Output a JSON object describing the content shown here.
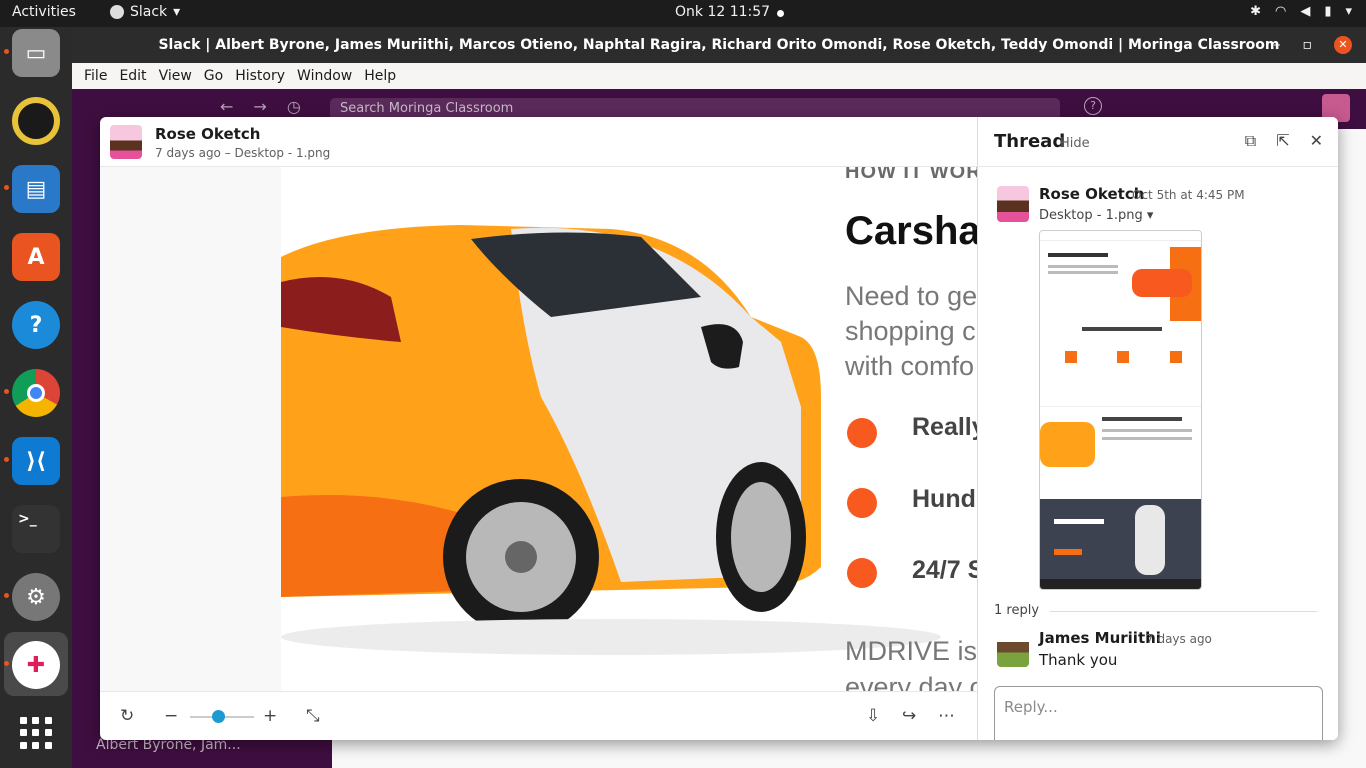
{
  "topbar": {
    "activities": "Activities",
    "app_name": "Slack",
    "clock": "Onk 12  11:57"
  },
  "window": {
    "title": "Slack | Albert Byrone, James Muriithi, Marcos Otieno, Naphtal Ragira, Richard Orito Omondi, Rose Oketch, Teddy Omondi | Moringa Classroom"
  },
  "menubar": [
    "File",
    "Edit",
    "View",
    "Go",
    "History",
    "Window",
    "Help"
  ],
  "slack": {
    "search_placeholder": "Search Moringa Classroom",
    "bottom_channel": "Albert Byrone, Jam..."
  },
  "preview": {
    "author": "Rose Oketch",
    "meta": "7 days ago – Desktop - 1.png",
    "slide": {
      "heading_small": "HOW IT WORK",
      "heading": "Carshar",
      "need_lines": [
        "Need to ge",
        "shopping c",
        "with comfo"
      ],
      "features": [
        "Really",
        "Hundr",
        "24/7 S"
      ],
      "mdrive_lines": [
        "MDRIVE is",
        "every day o"
      ]
    }
  },
  "thread": {
    "title": "Thread",
    "hide": "Hide",
    "post": {
      "author": "Rose Oketch",
      "time": "Oct 5th at 4:45 PM",
      "file": "Desktop - 1.png"
    },
    "reply_count": "1 reply",
    "reply": {
      "author": "James Muriithi",
      "time": "7 days ago",
      "text": "Thank you"
    },
    "reply_placeholder": "Reply..."
  }
}
